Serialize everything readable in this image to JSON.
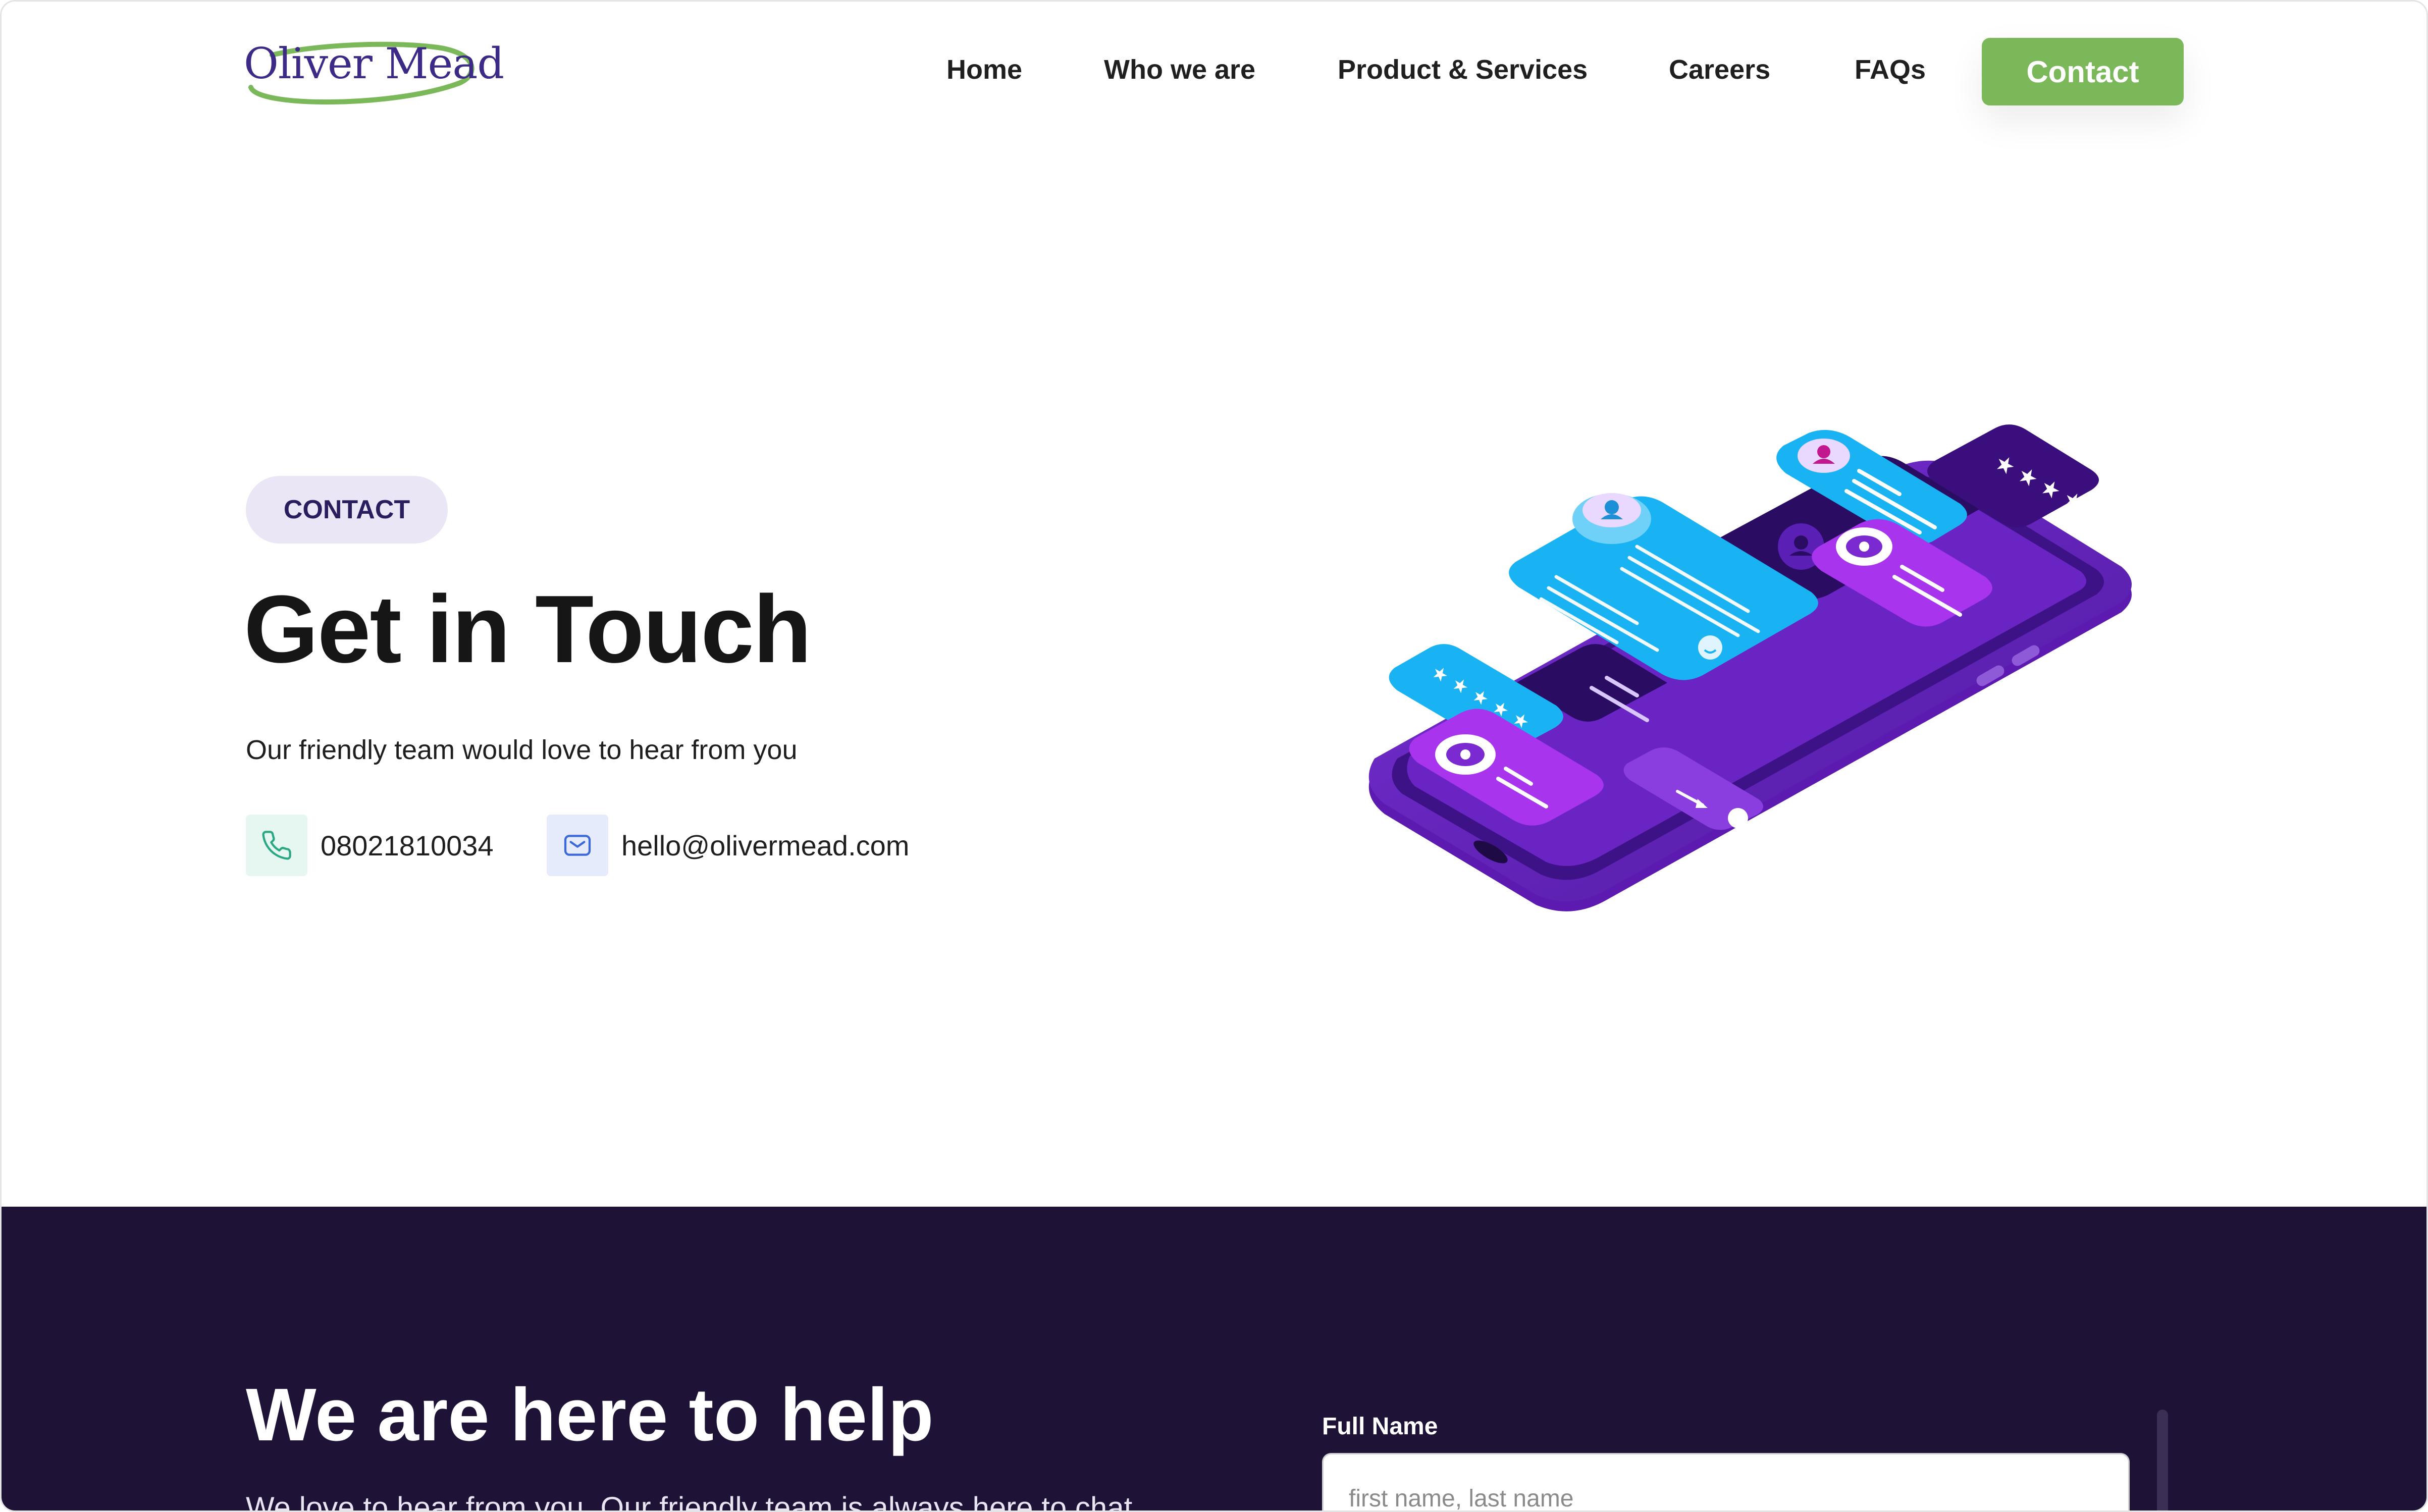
{
  "header": {
    "logo_text": "Oliver Mead",
    "nav": [
      "Home",
      "Who we are",
      "Product & Services",
      "Careers",
      "FAQs"
    ],
    "cta_label": "Contact"
  },
  "hero": {
    "badge": "CONTACT",
    "title": "Get in Touch",
    "subtitle": "Our friendly team would love to hear from you",
    "phone": "08021810034",
    "email": "hello@olivermead.com",
    "phone_icon": "phone-icon",
    "email_icon": "mail-icon"
  },
  "help": {
    "title": "We are here to help",
    "subtitle": "We love to hear from you. Our friendly team is always here to chat.",
    "form": {
      "full_name_label": "Full Name",
      "full_name_placeholder": "first name, last name",
      "full_name_value": ""
    }
  },
  "colors": {
    "brand_green": "#7ab85a",
    "brand_purple": "#3c2a86",
    "dark_bg": "#1e1236",
    "badge_bg": "#ebe6f6"
  }
}
